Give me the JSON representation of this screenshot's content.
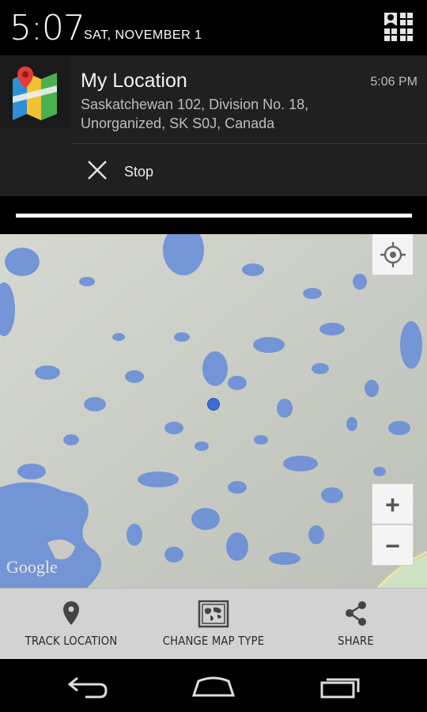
{
  "status": {
    "time": "5:07",
    "date": "SAT, NOVEMBER 1"
  },
  "notification": {
    "app_icon": "map-marker-app-icon",
    "title": "My Location",
    "time": "5:06 PM",
    "address_line1": "Saskatchewan 102, Division No. 18,",
    "address_line2": "Unorganized, SK S0J, Canada",
    "stop_label": "Stop"
  },
  "map": {
    "attribution": "Google",
    "zoom_in": "+",
    "zoom_out": "−",
    "colors": {
      "land": "#c9cdc4",
      "water": "#6a8fd8",
      "dot": "#3a6fd8"
    }
  },
  "actions": [
    {
      "label": "TRACK LOCATION",
      "icon": "pin-icon"
    },
    {
      "label": "CHANGE MAP TYPE",
      "icon": "world-map-icon"
    },
    {
      "label": "SHARE",
      "icon": "share-icon"
    }
  ],
  "navbar": {
    "back": "back-icon",
    "home": "home-icon",
    "recents": "recents-icon"
  }
}
